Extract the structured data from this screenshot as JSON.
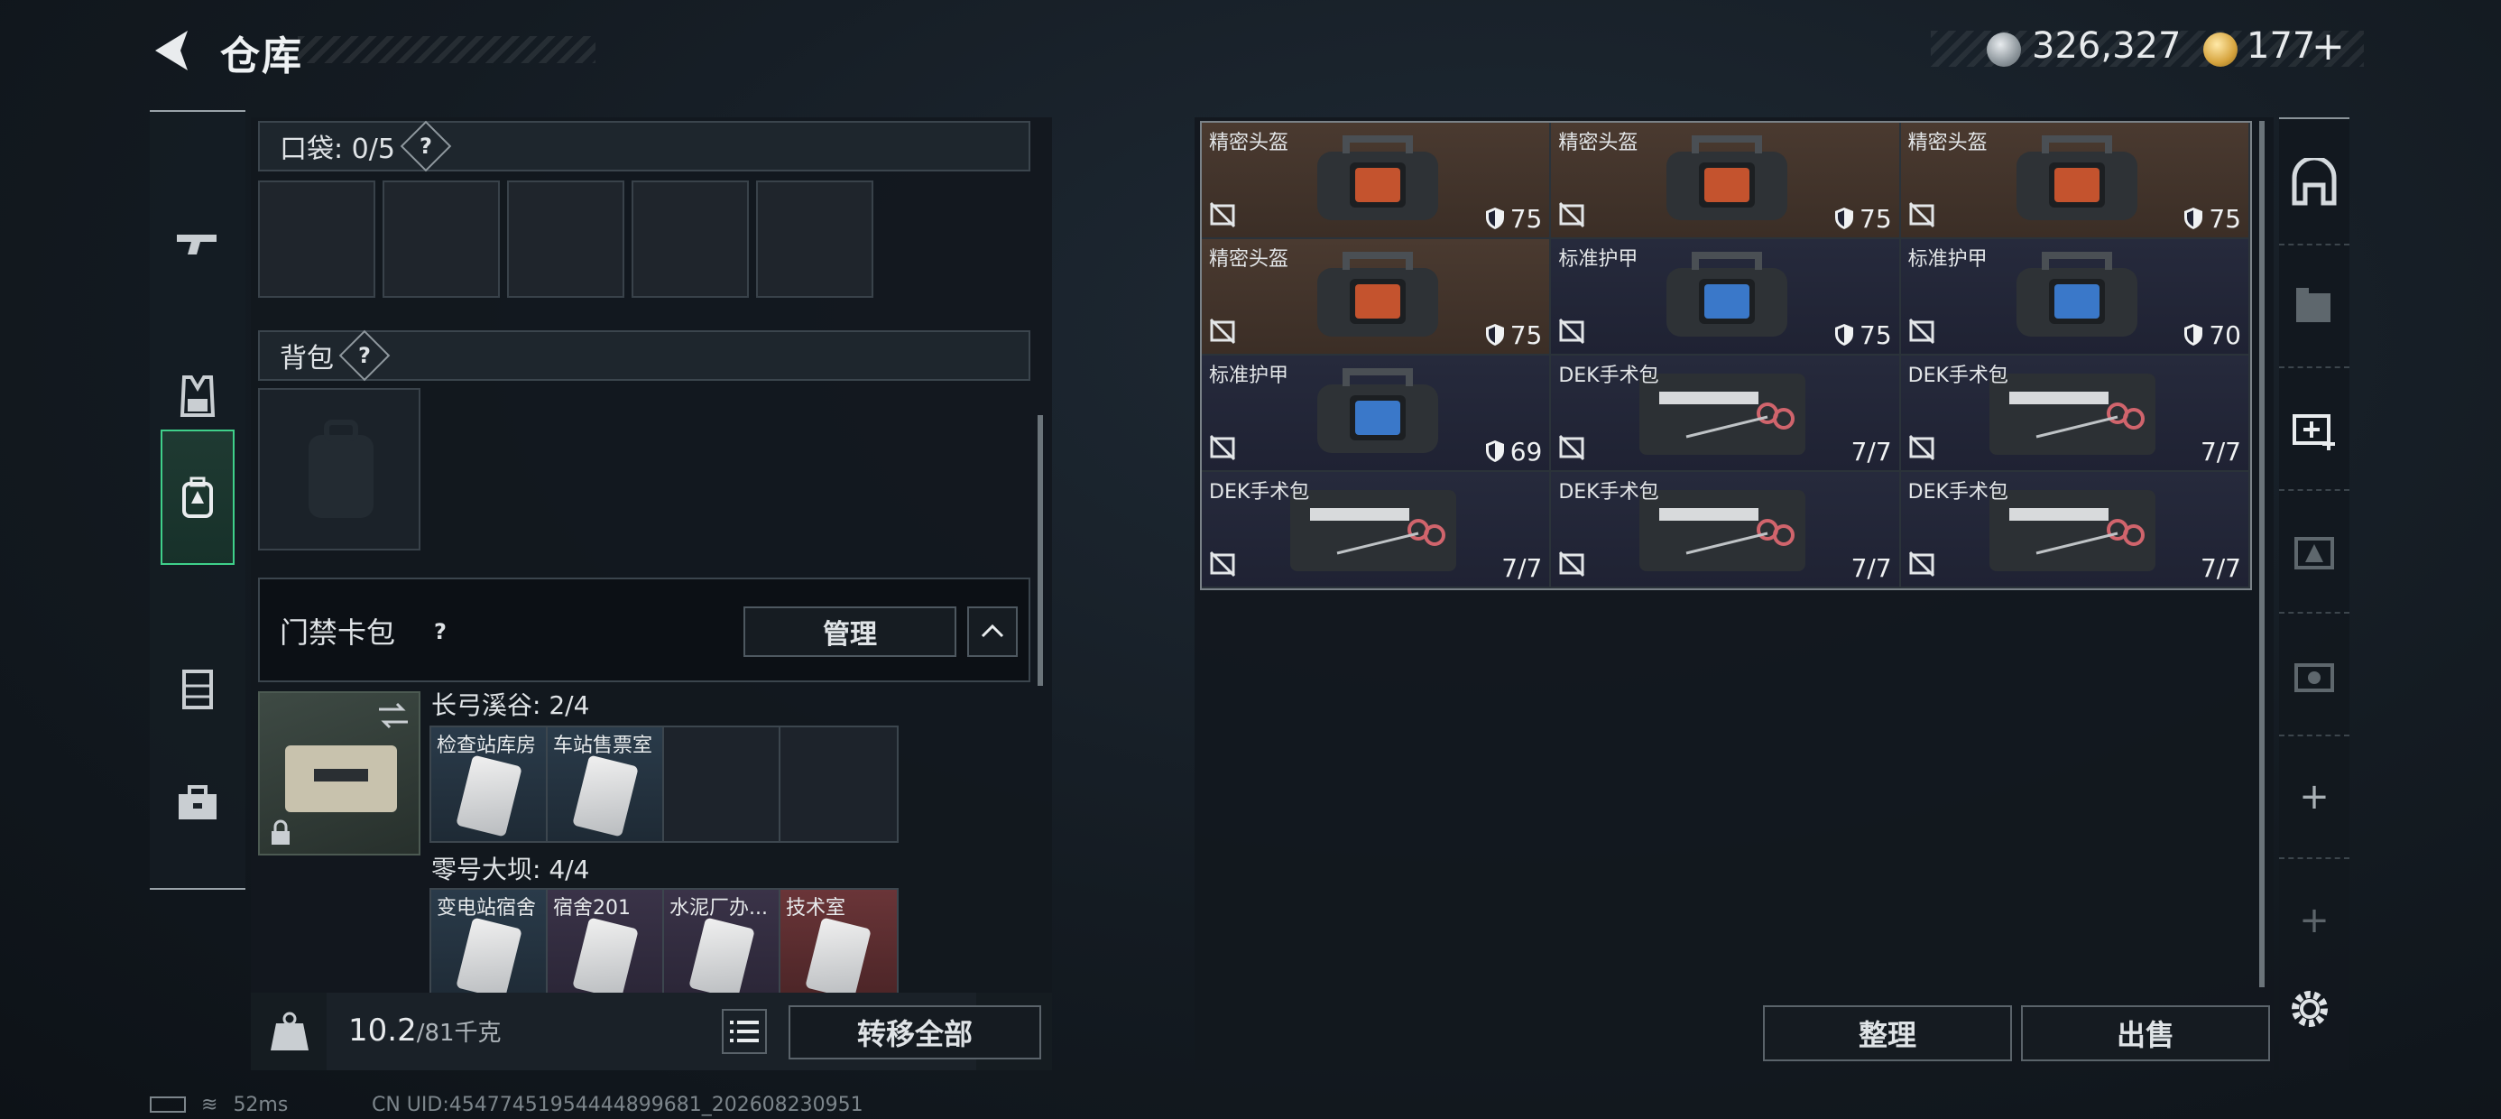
{
  "header": {
    "title": "仓库",
    "currency_silver": "326,327",
    "currency_gold": "177",
    "plus_label": "+"
  },
  "left": {
    "pocket_label": "口袋: 0/5",
    "backpack_label": "背包",
    "keycase_label": "门禁卡包",
    "manage_label": "管理",
    "question_mark": "?",
    "regions": [
      {
        "name": "长弓溪谷: 2/4",
        "keys": [
          {
            "name": "检查站库房",
            "tone": "blue"
          },
          {
            "name": "车站售票室",
            "tone": "blue"
          },
          {
            "name": "",
            "tone": "empty"
          },
          {
            "name": "",
            "tone": "empty"
          }
        ]
      },
      {
        "name": "零号大坝: 4/4",
        "keys": [
          {
            "name": "变电站宿舍",
            "tone": "blue"
          },
          {
            "name": "宿舍201",
            "tone": "purple"
          },
          {
            "name": "水泥厂办...",
            "tone": "purple"
          },
          {
            "name": "技术室",
            "tone": "red"
          }
        ]
      }
    ],
    "weight_current": "10.2",
    "weight_max": "/81千克",
    "transfer_all": "转移全部"
  },
  "right": {
    "items": [
      {
        "name": "精密头盔",
        "value": "75",
        "kind": "helmet",
        "tone": "brown",
        "icon": "shield-icon"
      },
      {
        "name": "精密头盔",
        "value": "75",
        "kind": "helmet",
        "tone": "brown",
        "icon": "shield-icon"
      },
      {
        "name": "精密头盔",
        "value": "75",
        "kind": "helmet",
        "tone": "brown",
        "icon": "shield-icon"
      },
      {
        "name": "精密头盔",
        "value": "75",
        "kind": "helmet",
        "tone": "brown",
        "icon": "shield-icon"
      },
      {
        "name": "标准护甲",
        "value": "75",
        "kind": "armor",
        "tone": "navy",
        "icon": "shield-icon"
      },
      {
        "name": "标准护甲",
        "value": "70",
        "kind": "armor",
        "tone": "navy",
        "icon": "shield-icon"
      },
      {
        "name": "标准护甲",
        "value": "69",
        "kind": "armor",
        "tone": "navy",
        "icon": "shield-icon"
      },
      {
        "name": "DEK手术包",
        "value": "7/7",
        "kind": "kit",
        "tone": "navy",
        "icon": ""
      },
      {
        "name": "DEK手术包",
        "value": "7/7",
        "kind": "kit",
        "tone": "navy",
        "icon": ""
      },
      {
        "name": "DEK手术包",
        "value": "7/7",
        "kind": "kit",
        "tone": "navy",
        "icon": ""
      },
      {
        "name": "DEK手术包",
        "value": "7/7",
        "kind": "kit",
        "tone": "navy",
        "icon": ""
      },
      {
        "name": "DEK手术包",
        "value": "7/7",
        "kind": "kit",
        "tone": "navy",
        "icon": ""
      }
    ],
    "tidy_label": "整理",
    "sell_label": "出售"
  },
  "status": {
    "ping": "52ms",
    "uid": "CN UID:45477451954444899681_202608230951"
  }
}
